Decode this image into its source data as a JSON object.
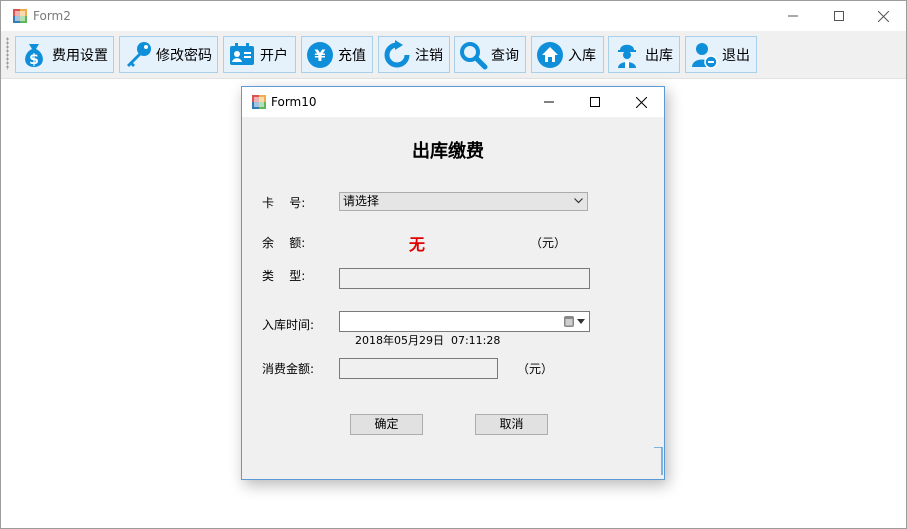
{
  "main_window": {
    "title": "Form2",
    "caption": {
      "minimize": "—",
      "maximize": "☐",
      "close": "✕"
    }
  },
  "toolbar": {
    "buttons": [
      {
        "label": "费用设置",
        "icon": "money-bag-icon"
      },
      {
        "label": "修改密码",
        "icon": "key-icon"
      },
      {
        "label": "开户",
        "icon": "id-card-icon"
      },
      {
        "label": "充值",
        "icon": "yen-coin-icon"
      },
      {
        "label": "注销",
        "icon": "refresh-icon"
      },
      {
        "label": "查询",
        "icon": "search-icon"
      },
      {
        "label": "入库",
        "icon": "home-icon"
      },
      {
        "label": "出库",
        "icon": "worker-icon"
      },
      {
        "label": "退出",
        "icon": "user-logout-icon"
      }
    ]
  },
  "dialog": {
    "title": "Form10",
    "heading": "出库缴费",
    "card_label": "卡    号:",
    "card_select": "请选择",
    "balance_label": "余    额:",
    "balance_value": "无",
    "balance_unit": "（元）",
    "type_label": "类    型:",
    "type_value": "",
    "entry_time_label": "入库时间:",
    "entry_time_value": "2018年05月29日  07:11:28",
    "amount_label": "消费金额:",
    "amount_value": "",
    "amount_unit": "（元）",
    "ok_label": "确定",
    "cancel_label": "取消"
  },
  "colors": {
    "toolbar_icon": "#0f8fd9",
    "balance_value": "#e00000",
    "dialog_border": "#5b9bd5"
  }
}
